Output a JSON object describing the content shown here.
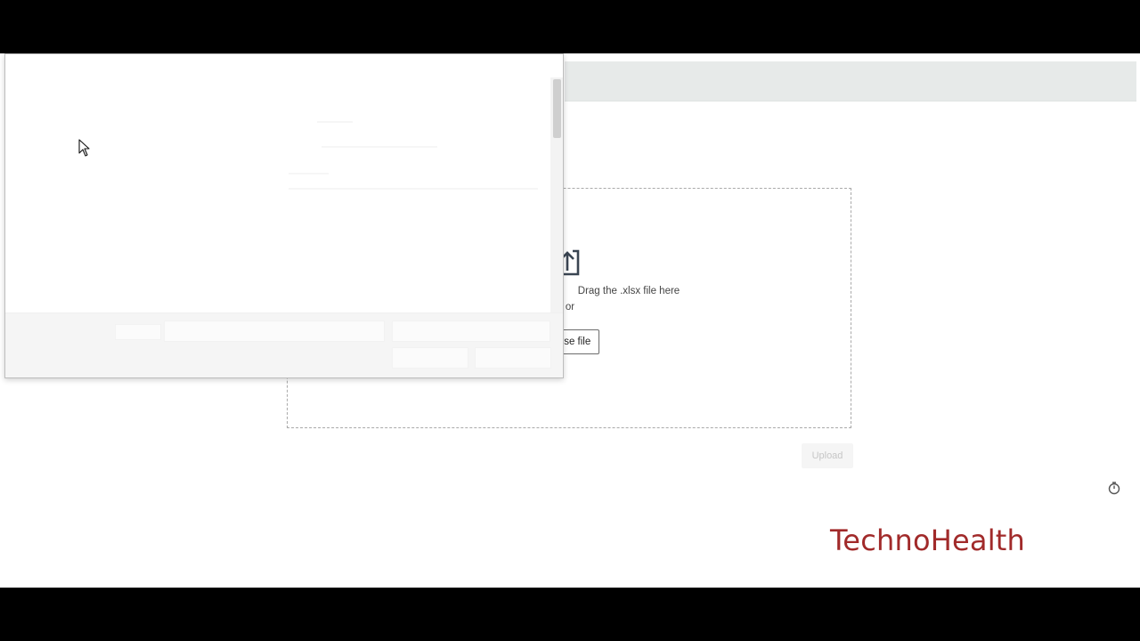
{
  "dropzone": {
    "drop_text": "Drag the .xlsx file here",
    "or_text": "or",
    "browse_label": "Browse file"
  },
  "actions": {
    "upload_label": "Upload"
  },
  "branding": {
    "watermark": "TechnoHealth",
    "color": "#a12a2a"
  },
  "icons": {
    "upload": "upload-arrow-icon",
    "timer": "stopwatch-icon",
    "cursor": "mouse-pointer-icon"
  }
}
